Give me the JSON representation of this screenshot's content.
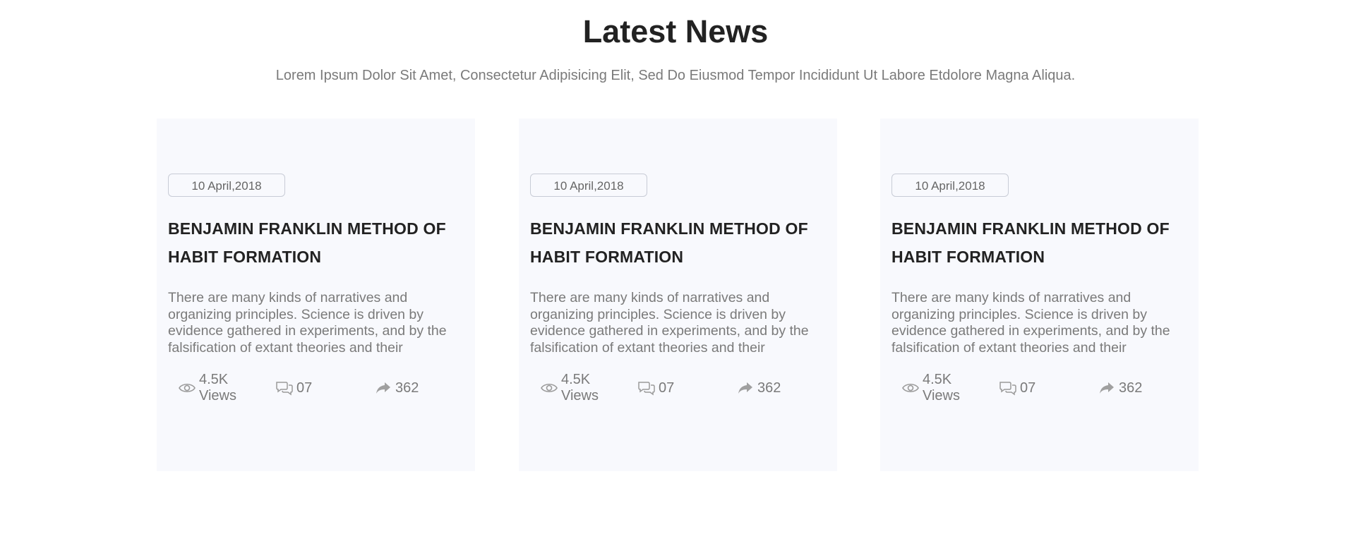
{
  "section": {
    "title": "Latest News",
    "subtitle": "Lorem Ipsum Dolor Sit Amet, Consectetur Adipisicing Elit, Sed Do Eiusmod Tempor Incididunt Ut Labore Etdolore Magna Aliqua."
  },
  "cards": [
    {
      "date": "10 April,2018",
      "title": "BENJAMIN FRANKLIN METHOD OF HABIT FORMATION",
      "text": "There are many kinds of narratives and organizing principles. Science is driven by evidence gathered in experiments, and by the falsification of extant theories and their",
      "views": "4.5K Views",
      "comments": "07",
      "shares": "362"
    },
    {
      "date": "10 April,2018",
      "title": "BENJAMIN FRANKLIN METHOD OF HABIT FORMATION",
      "text": "There are many kinds of narratives and organizing principles. Science is driven by evidence gathered in experiments, and by the falsification of extant theories and their",
      "views": "4.5K Views",
      "comments": "07",
      "shares": "362"
    },
    {
      "date": "10 April,2018",
      "title": "BENJAMIN FRANKLIN METHOD OF HABIT FORMATION",
      "text": "There are many kinds of narratives and organizing principles. Science is driven by evidence gathered in experiments, and by the falsification of extant theories and their",
      "views": "4.5K Views",
      "comments": "07",
      "shares": "362"
    }
  ],
  "icons": {
    "views": "eye-icon",
    "comments": "comments-icon",
    "shares": "share-icon"
  },
  "colors": {
    "card_background": "#f8f9fd",
    "title": "#222222",
    "muted_text": "#7a7a7a",
    "badge_border": "#c8ccd6"
  }
}
